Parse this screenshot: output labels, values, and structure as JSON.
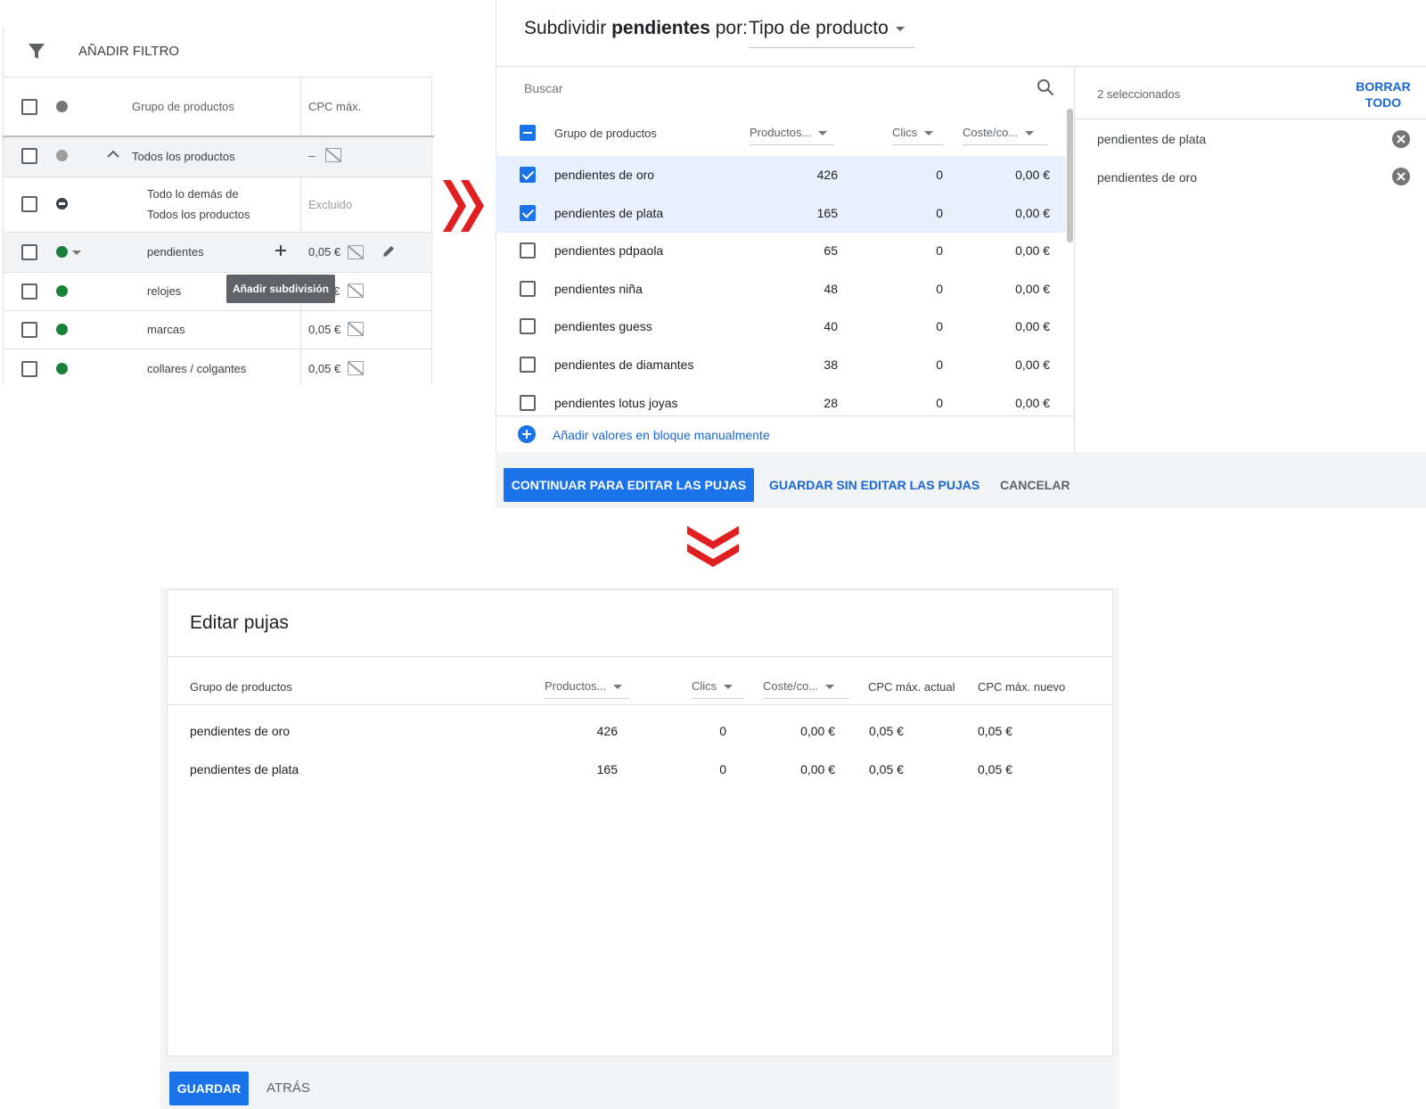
{
  "left_panel": {
    "filter_label": "AÑADIR FILTRO",
    "col_group": "Grupo de productos",
    "col_cpc": "CPC máx.",
    "rows": [
      {
        "name": "Todos los productos",
        "cpc": "–"
      },
      {
        "name_line1": "Todo lo demás de",
        "name_line2": "Todos los productos",
        "cpc": "Excluido"
      },
      {
        "name": "pendientes",
        "cpc": "0,05 €"
      },
      {
        "name": "relojes",
        "cpc": "€"
      },
      {
        "name": "marcas",
        "cpc": "0,05 €"
      },
      {
        "name": "collares / colgantes",
        "cpc": "0,05 €"
      }
    ],
    "tooltip": "Añadir subdivisión",
    "colors": {
      "green": "#188038",
      "grey": "#9e9e9e",
      "row_highlight": "#f1f3f4"
    }
  },
  "subdivide": {
    "title_prefix": "Subdividir ",
    "title_bold": "pendientes",
    "title_mid": " por: ",
    "dropdown": "Tipo de producto",
    "search_placeholder": "Buscar",
    "col_group": "Grupo de productos",
    "col_products": "Productos...",
    "col_clicks": "Clics",
    "col_cost": "Coste/co...",
    "rows": [
      {
        "name": "pendientes de oro",
        "products": "426",
        "clicks": "0",
        "cost": "0,00 €",
        "checked": true
      },
      {
        "name": "pendientes de plata",
        "products": "165",
        "clicks": "0",
        "cost": "0,00 €",
        "checked": true
      },
      {
        "name": "pendientes pdpaola",
        "products": "65",
        "clicks": "0",
        "cost": "0,00 €",
        "checked": false
      },
      {
        "name": "pendientes niña",
        "products": "48",
        "clicks": "0",
        "cost": "0,00 €",
        "checked": false
      },
      {
        "name": "pendientes guess",
        "products": "40",
        "clicks": "0",
        "cost": "0,00 €",
        "checked": false
      },
      {
        "name": "pendientes de diamantes",
        "products": "38",
        "clicks": "0",
        "cost": "0,00 €",
        "checked": false
      },
      {
        "name": "pendientes lotus joyas",
        "products": "28",
        "clicks": "0",
        "cost": "0,00 €",
        "checked": false
      }
    ],
    "add_bulk": "Añadir valores en bloque manualmente",
    "selected_count": "2 seleccionados",
    "clear_line1": "BORRAR",
    "clear_line2": "TODO",
    "selected_items": [
      "pendientes de plata",
      "pendientes de oro"
    ],
    "btn_continue": "CONTINUAR PARA EDITAR LAS PUJAS",
    "btn_save_no_edit": "GUARDAR SIN EDITAR LAS PUJAS",
    "btn_cancel": "CANCELAR"
  },
  "edit_bids": {
    "title": "Editar pujas",
    "col_group": "Grupo de productos",
    "col_products": "Productos...",
    "col_clicks": "Clics",
    "col_cost": "Coste/co...",
    "col_cpc_current": "CPC máx. actual",
    "col_cpc_new": "CPC máx. nuevo",
    "rows": [
      {
        "name": "pendientes de oro",
        "products": "426",
        "clicks": "0",
        "cost": "0,00 €",
        "cpc_current": "0,05 €",
        "cpc_new": "0,05 €"
      },
      {
        "name": "pendientes de plata",
        "products": "165",
        "clicks": "0",
        "cost": "0,00 €",
        "cpc_current": "0,05 €",
        "cpc_new": "0,05 €"
      }
    ],
    "btn_save": "GUARDAR",
    "btn_back": "ATRÁS"
  },
  "colors": {
    "accent": "#1a73e8",
    "link": "#1967d2",
    "arrow_red": "#e02020",
    "footer_bg": "#f1f3f4"
  }
}
